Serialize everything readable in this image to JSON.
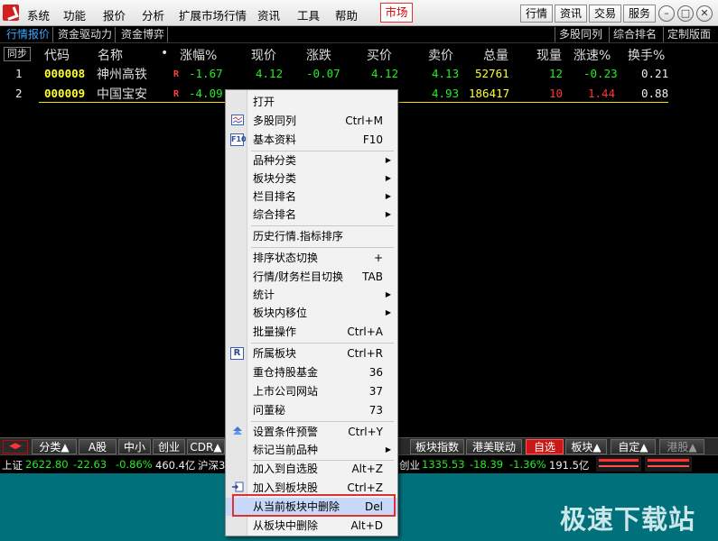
{
  "menubar": {
    "items": [
      "系统",
      "功能",
      "报价",
      "分析",
      "扩展市场行情",
      "资讯",
      "工具",
      "帮助"
    ],
    "market_tab": "市场",
    "right_buttons": [
      "行情",
      "资讯",
      "交易",
      "服务"
    ]
  },
  "tabs": {
    "left": [
      "行情报价",
      "资金驱动力",
      "资金博弈"
    ],
    "right": [
      "多股同列",
      "综合排名",
      "定制版面"
    ]
  },
  "table": {
    "sync_label": "同步",
    "headers": [
      "代码",
      "名称",
      "•",
      "涨幅%",
      "现价",
      "涨跌",
      "买价",
      "卖价",
      "总量",
      "现量",
      "涨速%",
      "换手%"
    ],
    "rows": [
      {
        "idx": "1",
        "code": "000008",
        "name": "神州高铁",
        "flag": "R",
        "chg_pct": "-1.67",
        "price": "4.12",
        "chg": "-0.07",
        "bid": "4.12",
        "ask": "4.13",
        "volume": "52761",
        "cur_vol": "12",
        "speed": "-0.23",
        "turnover": "0.21"
      },
      {
        "idx": "2",
        "code": "000009",
        "name": "中国宝安",
        "flag": "R",
        "chg_pct": "-4.09",
        "price": "",
        "chg": "",
        "bid": "",
        "ask": "4.93",
        "volume": "186417",
        "cur_vol": "10",
        "speed": "1.44",
        "turnover": "0.88"
      }
    ]
  },
  "bottom_tabs": [
    "分类▲",
    "A股",
    "中小",
    "创业",
    "CDR▲",
    "板块指数",
    "港美联动",
    "自选",
    "板块▲",
    "自定▲",
    "港股▲"
  ],
  "statusbar": {
    "sh_label": "上证",
    "sh_index": "2622.80",
    "sh_chg": "-22.63",
    "sh_pct": "-0.86%",
    "sh_amount": "460.4亿",
    "sz_label": "沪深3",
    "cy_label": "创业",
    "cy_index": "1335.53",
    "cy_chg": "-18.39",
    "cy_pct": "-1.36%",
    "cy_amount": "191.5亿"
  },
  "watermark": "极速下载站",
  "context_menu": {
    "items": [
      {
        "label": "打开",
        "shortcut": ""
      },
      {
        "label": "多股同列",
        "shortcut": "Ctrl+M",
        "icon": "multi-chart-icon"
      },
      {
        "label": "基本资料",
        "shortcut": "F10",
        "icon": "f10-icon"
      },
      {
        "label": "品种分类",
        "shortcut": "",
        "submenu": true
      },
      {
        "label": "板块分类",
        "shortcut": "",
        "submenu": true
      },
      {
        "label": "栏目排名",
        "shortcut": "",
        "submenu": true
      },
      {
        "label": "综合排名",
        "shortcut": "",
        "submenu": true
      },
      {
        "label": "历史行情.指标排序",
        "shortcut": ""
      },
      {
        "label": "排序状态切换",
        "shortcut": "+"
      },
      {
        "label": "行情/财务栏目切换",
        "shortcut": "TAB"
      },
      {
        "label": "统计",
        "shortcut": "",
        "submenu": true
      },
      {
        "label": "板块内移位",
        "shortcut": "",
        "submenu": true
      },
      {
        "label": "批量操作",
        "shortcut": "Ctrl+A"
      },
      {
        "label": "所属板块",
        "shortcut": "Ctrl+R",
        "icon": "r-icon"
      },
      {
        "label": "重仓持股基金",
        "shortcut": "36"
      },
      {
        "label": "上市公司网站",
        "shortcut": "37"
      },
      {
        "label": "问董秘",
        "shortcut": "73"
      },
      {
        "label": "设置条件预警",
        "shortcut": "Ctrl+Y",
        "icon": "alert-icon"
      },
      {
        "label": "标记当前品种",
        "shortcut": "",
        "submenu": true
      },
      {
        "label": "加入到自选股",
        "shortcut": "Alt+Z"
      },
      {
        "label": "加入到板块股",
        "shortcut": "Ctrl+Z",
        "icon": "add-to-block-icon"
      },
      {
        "label": "从当前板块中删除",
        "shortcut": "Del"
      },
      {
        "label": "从板块中删除",
        "shortcut": "Alt+D"
      }
    ]
  }
}
